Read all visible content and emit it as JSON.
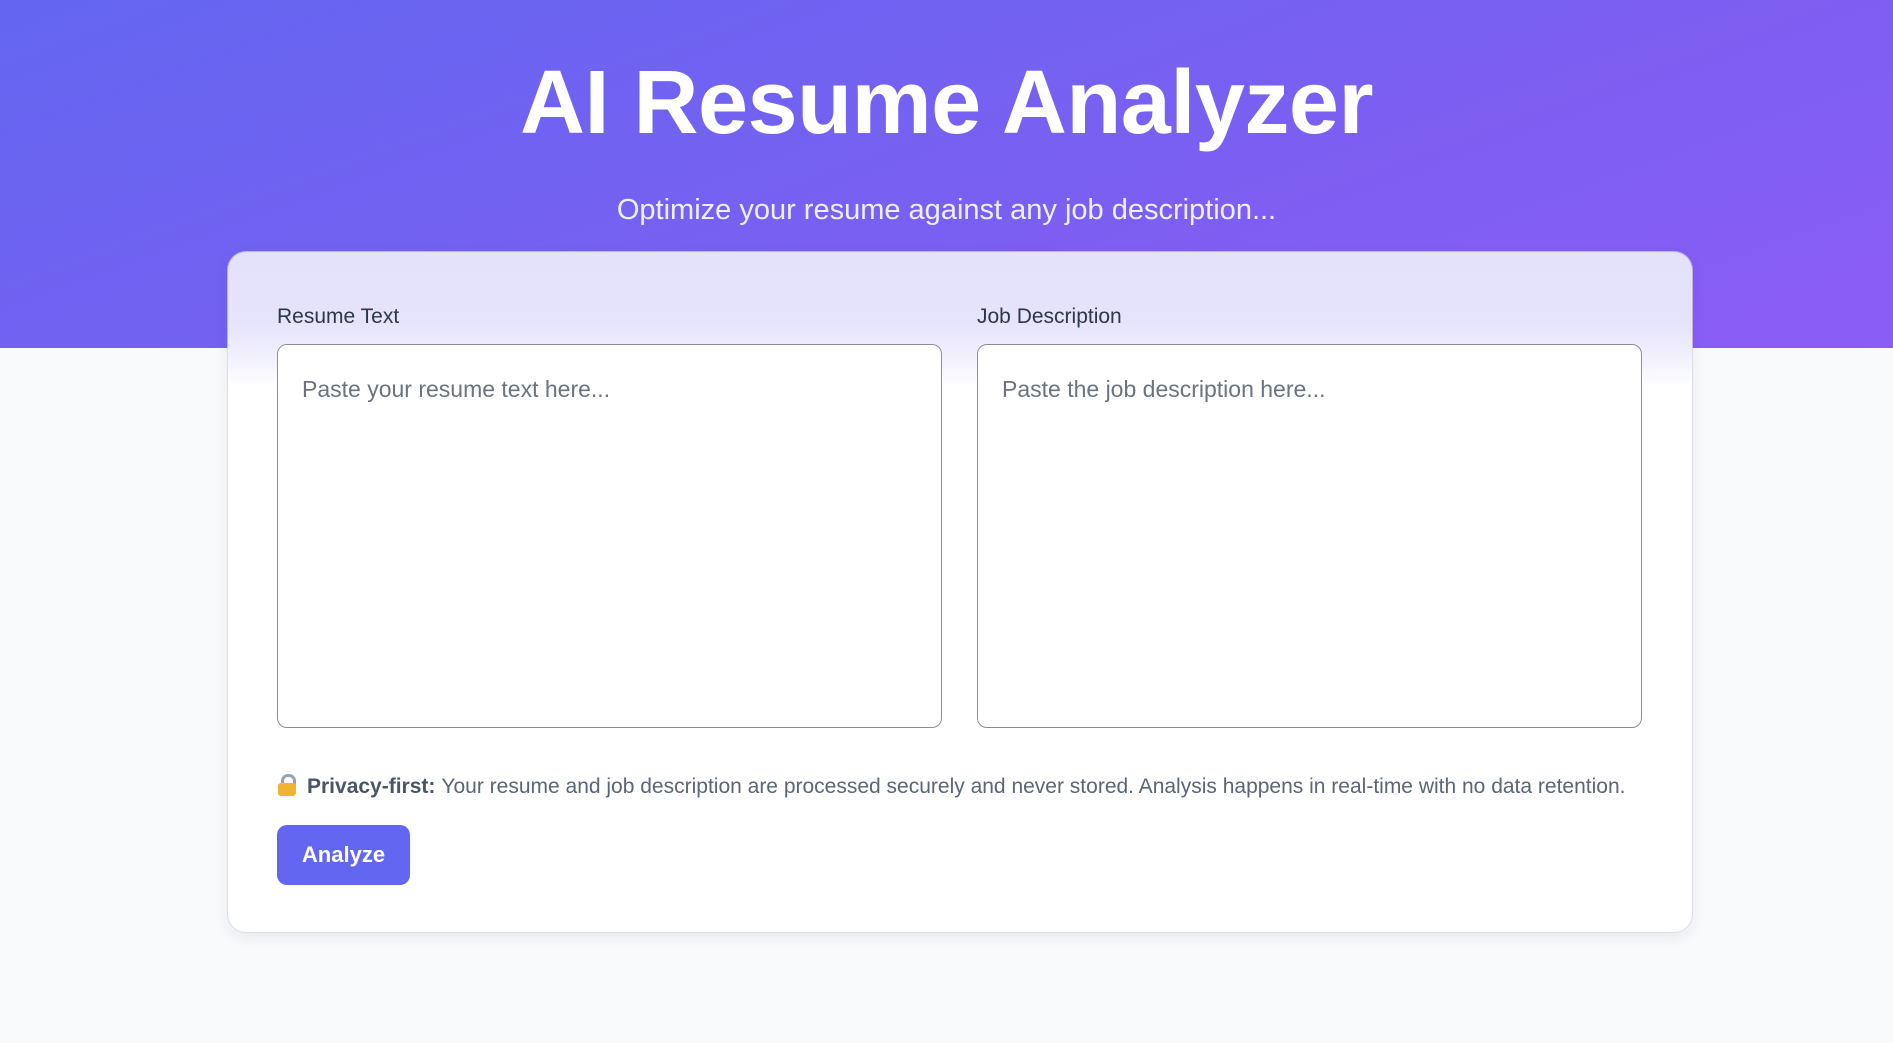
{
  "header": {
    "title": "AI Resume Analyzer",
    "subtitle": "Optimize your resume against any job description..."
  },
  "form": {
    "resume": {
      "label": "Resume Text",
      "placeholder": "Paste your resume text here...",
      "value": ""
    },
    "job": {
      "label": "Job Description",
      "placeholder": "Paste the job description here...",
      "value": ""
    }
  },
  "privacy": {
    "icon": "lock-icon",
    "strong": "Privacy-first:",
    "text": "Your resume and job description are processed securely and never stored. Analysis happens in real-time with no data retention."
  },
  "actions": {
    "analyze_label": "Analyze"
  },
  "colors": {
    "accent": "#6366f1",
    "hero_gradient_start": "#6366f1",
    "hero_gradient_end": "#8b5cf6",
    "page_background": "#f8f9fb"
  }
}
